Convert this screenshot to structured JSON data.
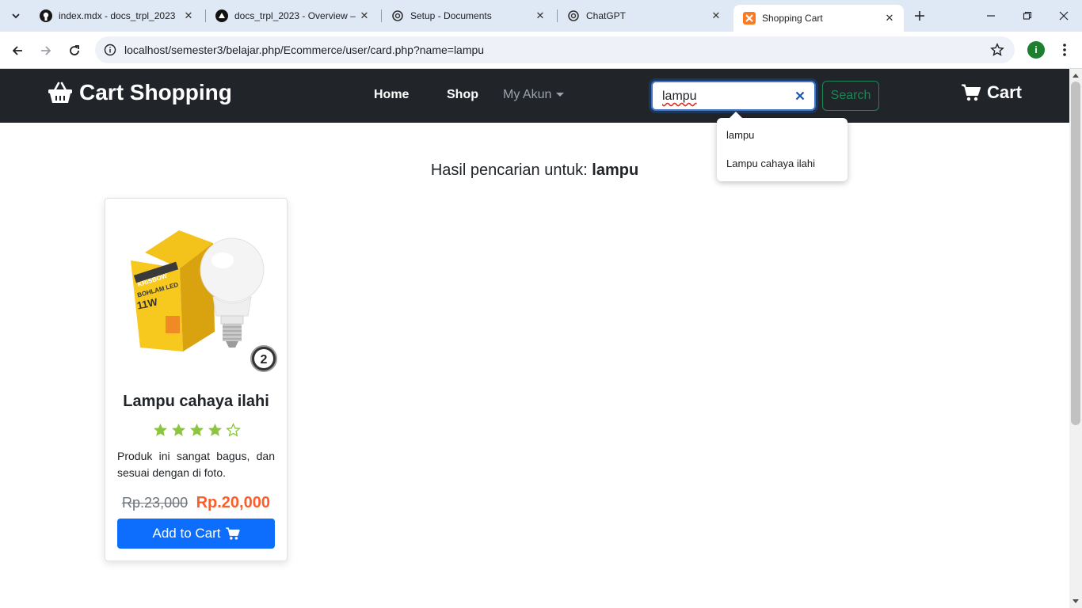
{
  "browser": {
    "tabs": [
      {
        "title": "index.mdx - docs_trpl_2023",
        "icon": "github-icon"
      },
      {
        "title": "docs_trpl_2023 - Overview –",
        "icon": "vercel-icon"
      },
      {
        "title": "Setup - Documents",
        "icon": "openai-icon"
      },
      {
        "title": "ChatGPT",
        "icon": "openai-icon"
      },
      {
        "title": "Shopping Cart",
        "icon": "xampp-icon"
      }
    ],
    "url": "localhost/semester3/belajar.php/Ecommerce/user/card.php?name=lampu",
    "profile_initial": "i"
  },
  "navbar": {
    "brand": "Cart Shopping",
    "links": {
      "home": "Home",
      "shop": "Shop",
      "account": "My Akun"
    },
    "search": {
      "value": "lampu",
      "button": "Search"
    },
    "cart": "Cart"
  },
  "autocomplete": {
    "options": [
      "lampu",
      "Lampu cahaya ilahi"
    ]
  },
  "results": {
    "prefix": "Hasil pencarian untuk:",
    "query": "lampu"
  },
  "product": {
    "name": "Lampu cahaya ilahi",
    "rating": 4,
    "rating_max": 5,
    "description": "Produk ini sangat bagus, dan sesuai dengan di foto.",
    "old_price": "Rp.23,000",
    "price": "Rp.20,000",
    "add_button": "Add to Cart",
    "image_text": {
      "brand": "KRISBOW",
      "label": "BOHLAM LED",
      "watt": "11W",
      "badge": "2"
    }
  },
  "colors": {
    "navbar": "#212529",
    "success": "#198754",
    "primary": "#0d6efd",
    "price": "#fd5d29",
    "star": "#8cc63f"
  }
}
